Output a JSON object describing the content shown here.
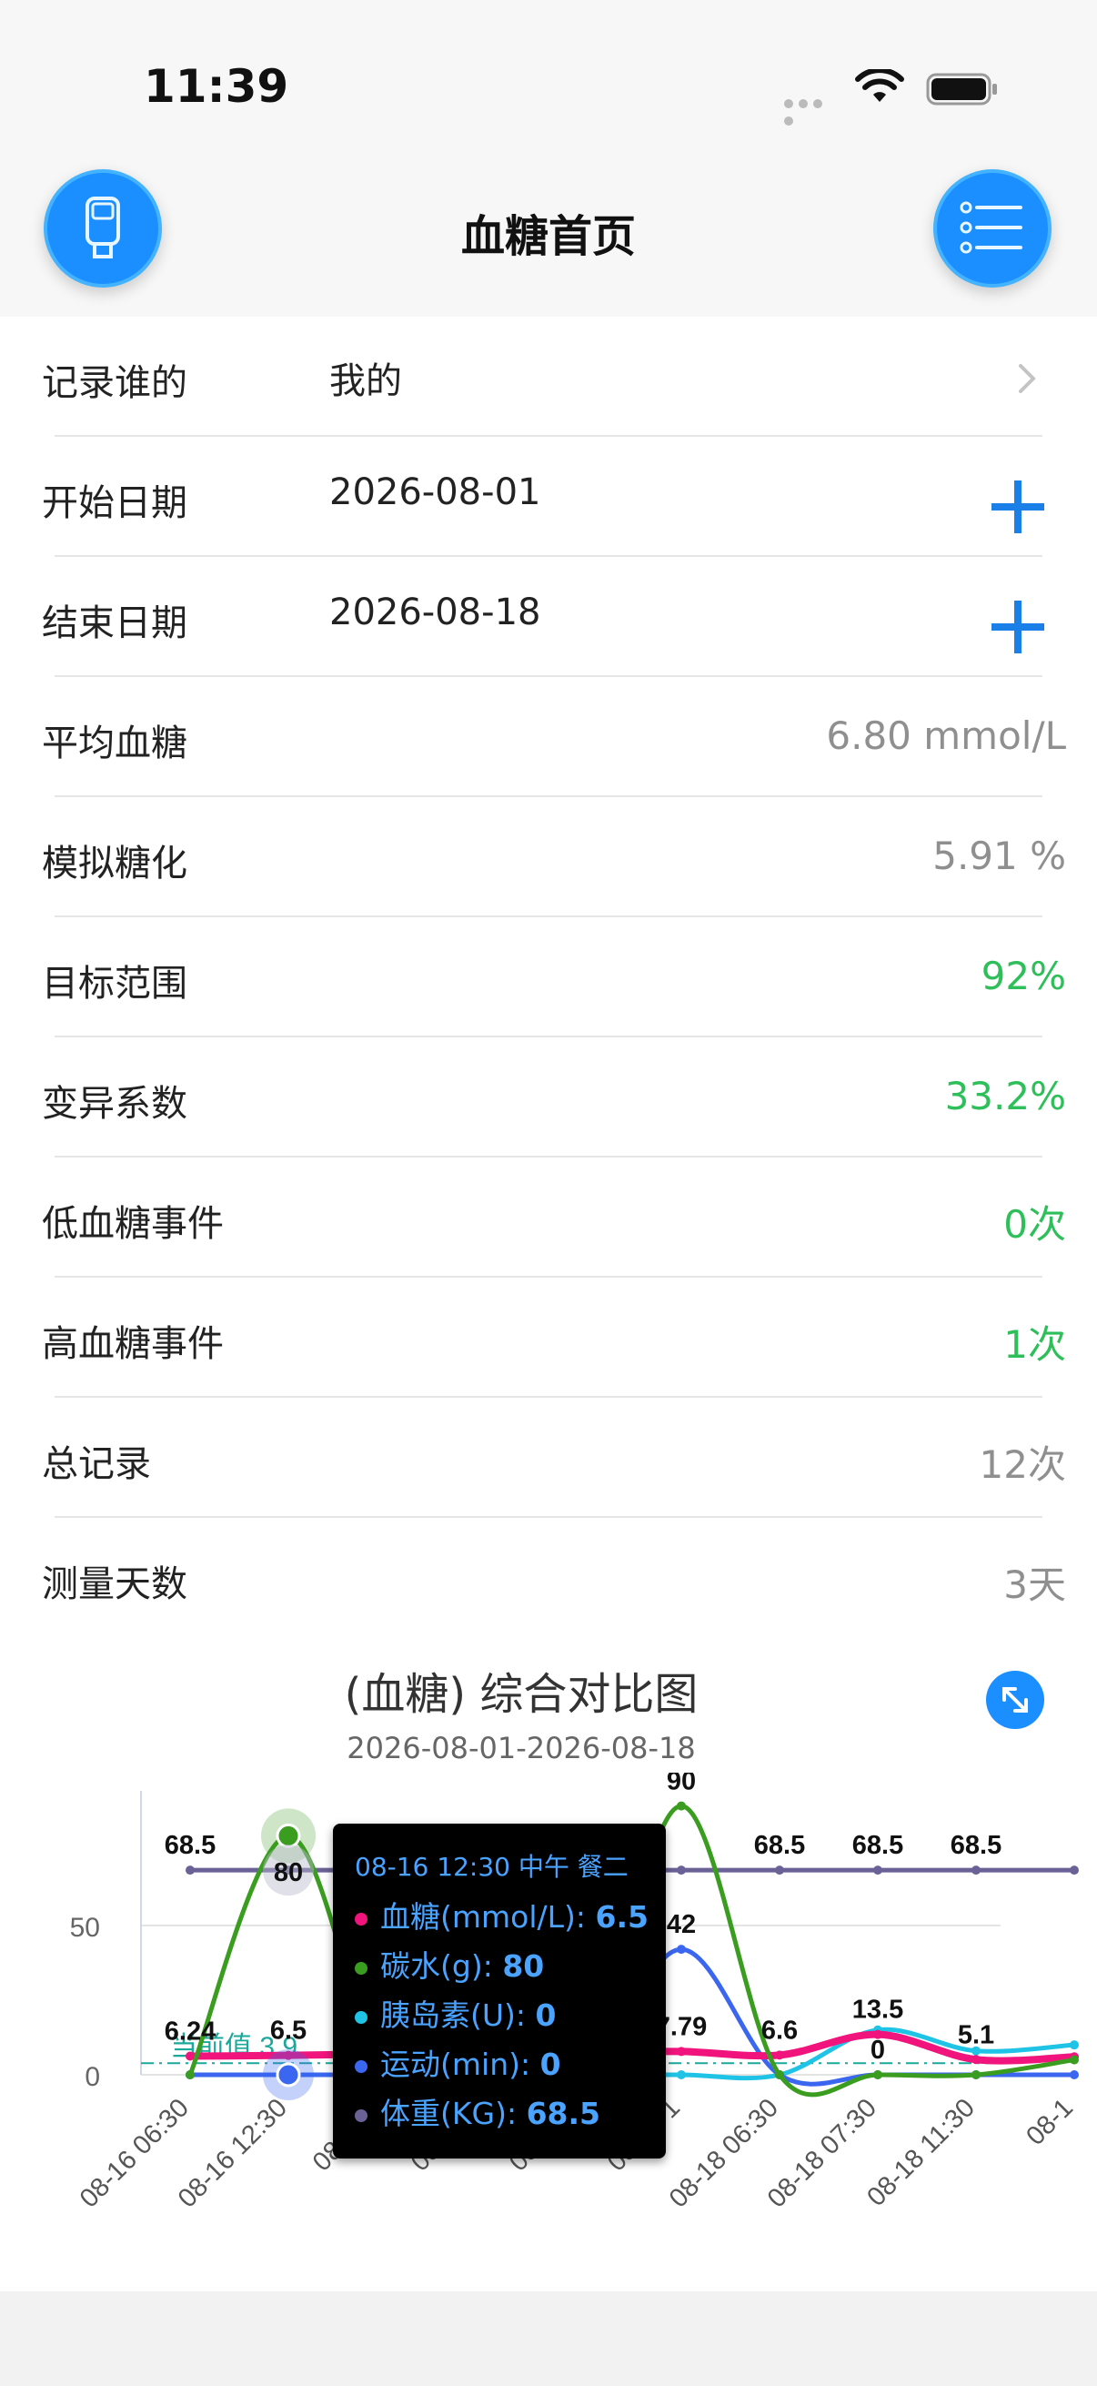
{
  "status": {
    "time": "11:39"
  },
  "nav": {
    "title": "血糖首页"
  },
  "rows": [
    {
      "label": "记录谁的",
      "value": "我的",
      "value_side": "left",
      "action": "chevron"
    },
    {
      "label": "开始日期",
      "value": "2026-08-01",
      "value_side": "left",
      "action": "plus"
    },
    {
      "label": "结束日期",
      "value": "2026-08-18",
      "value_side": "left",
      "action": "plus"
    },
    {
      "label": "平均血糖",
      "value": "6.80 mmol/L",
      "value_side": "right",
      "color": "grey"
    },
    {
      "label": "模拟糖化",
      "value": "5.91 %",
      "value_side": "right",
      "color": "grey"
    },
    {
      "label": "目标范围",
      "value": "92%",
      "value_side": "right",
      "color": "green"
    },
    {
      "label": "变异系数",
      "value": "33.2%",
      "value_side": "right",
      "color": "green"
    },
    {
      "label": "低血糖事件",
      "value": "0次",
      "value_side": "right",
      "color": "green"
    },
    {
      "label": "高血糖事件",
      "value": "1次",
      "value_side": "right",
      "color": "green"
    },
    {
      "label": "总记录",
      "value": "12次",
      "value_side": "right",
      "color": "grey"
    },
    {
      "label": "测量天数",
      "value": "3天",
      "value_side": "right",
      "color": "grey"
    }
  ],
  "chart": {
    "title": "(血糖) 综合对比图",
    "subtitle": "2026-08-01-2026-08-18"
  },
  "chart_data": {
    "type": "line",
    "title": "(血糖) 综合对比图",
    "subtitle": "2026-08-01-2026-08-18",
    "categories": [
      "08-16 06:30",
      "08-16 12:30",
      "08-16 1",
      "08-17 0",
      "08-17 1",
      "08-17 1",
      "08-18 06:30",
      "08-18 07:30",
      "08-18 11:30",
      "08-1"
    ],
    "yticks": [
      0,
      50
    ],
    "ylim": [
      0,
      92
    ],
    "reference_line": {
      "label": "当前值 3.9",
      "value": 3.9,
      "color": "#1aa89a"
    },
    "series": [
      {
        "name": "血糖(mmol/L)",
        "color": "#f0147c",
        "values": [
          6.24,
          6.5,
          7.0,
          7.2,
          7.5,
          7.79,
          6.6,
          13.5,
          5.1,
          6.0
        ]
      },
      {
        "name": "碳水(g)",
        "color": "#3a9d1f",
        "values": [
          0,
          80,
          0,
          0,
          0,
          90,
          0,
          0,
          0,
          5
        ]
      },
      {
        "name": "胰岛素(U)",
        "color": "#1fc3e6",
        "values": [
          0,
          0,
          0,
          0,
          0,
          0,
          0,
          15,
          8,
          10
        ]
      },
      {
        "name": "运动(min)",
        "color": "#3a66f0",
        "values": [
          0,
          0,
          0,
          0,
          0,
          42,
          0,
          0,
          0,
          0
        ]
      },
      {
        "name": "体重(KG)",
        "color": "#6a6296",
        "values": [
          68.5,
          68.5,
          68.5,
          68.5,
          68.5,
          68.5,
          68.5,
          68.5,
          68.5,
          68.5
        ]
      }
    ],
    "data_labels": [
      {
        "text": "68.5",
        "series": 4,
        "index": 0
      },
      {
        "text": "80",
        "series": 1,
        "index": 1
      },
      {
        "text": "90",
        "series": 1,
        "index": 5
      },
      {
        "text": "68.5",
        "series": 4,
        "index": 6
      },
      {
        "text": "68.5",
        "series": 4,
        "index": 7
      },
      {
        "text": "68.5",
        "series": 4,
        "index": 8
      },
      {
        "text": "6.24",
        "series": 0,
        "index": 0
      },
      {
        "text": "6.5",
        "series": 0,
        "index": 1
      },
      {
        "text": "42",
        "series": 3,
        "index": 5
      },
      {
        "text": "7.79",
        "series": 0,
        "index": 5
      },
      {
        "text": "6.6",
        "series": 0,
        "index": 6
      },
      {
        "text": "13.5",
        "series": 0,
        "index": 7
      },
      {
        "text": "0",
        "series": 3,
        "index": 7
      },
      {
        "text": "5.1",
        "series": 0,
        "index": 8
      }
    ]
  },
  "tooltip": {
    "header": "08-16 12:30 中午 餐二",
    "items": [
      {
        "name": "血糖(mmol/L): ",
        "value": "6.5",
        "color": "#f0147c"
      },
      {
        "name": "碳水(g): ",
        "value": "80",
        "color": "#3a9d1f"
      },
      {
        "name": "胰岛素(U): ",
        "value": "0",
        "color": "#1fc3e6"
      },
      {
        "name": "运动(min): ",
        "value": "0",
        "color": "#3a66f0"
      },
      {
        "name": "体重(KG): ",
        "value": "68.5",
        "color": "#6a6296"
      }
    ]
  }
}
